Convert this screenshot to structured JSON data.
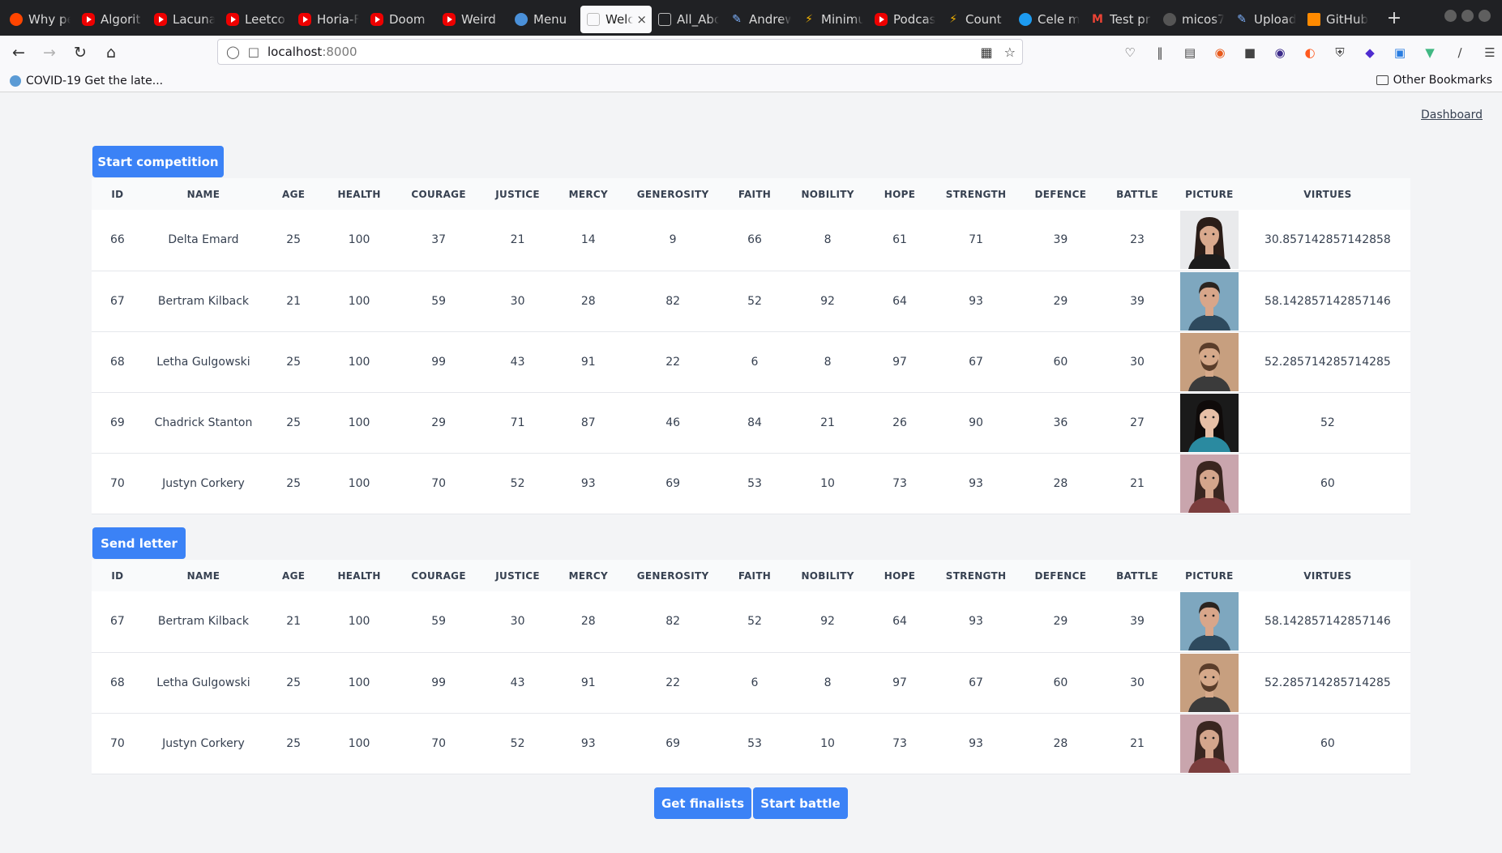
{
  "browser": {
    "tabs": [
      {
        "label": "Why pe",
        "icon": "reddit-icon"
      },
      {
        "label": "Algorit",
        "icon": "youtube-icon"
      },
      {
        "label": "Lacuna",
        "icon": "youtube-icon"
      },
      {
        "label": "Leetco",
        "icon": "youtube-icon"
      },
      {
        "label": "Horia-F",
        "icon": "youtube-icon"
      },
      {
        "label": "Doom",
        "icon": "youtube-icon"
      },
      {
        "label": "Weird",
        "icon": "youtube-icon"
      },
      {
        "label": "Menu",
        "icon": "globe-icon"
      },
      {
        "label": "Welcom",
        "icon": "blank-page-icon",
        "active": true
      },
      {
        "label": "All_About",
        "icon": "blank-page-icon"
      },
      {
        "label": "Andrew",
        "icon": "pen-icon"
      },
      {
        "label": "Minimu",
        "icon": "bolt-icon"
      },
      {
        "label": "Podcas",
        "icon": "youtube-icon"
      },
      {
        "label": "Count",
        "icon": "bolt-icon"
      },
      {
        "label": "Cele m",
        "icon": "twitter-bird-icon"
      },
      {
        "label": "Test pr",
        "icon": "gmail-icon"
      },
      {
        "label": "micos7",
        "icon": "github-icon"
      },
      {
        "label": "Upload",
        "icon": "pen-icon"
      },
      {
        "label": "GitHub",
        "icon": "grid-icon"
      }
    ],
    "url_host": "localhost",
    "url_port": ":8000",
    "bookmark": "COVID-19 Get the late...",
    "other_bookmarks": "Other Bookmarks",
    "accent": "#3b82f6"
  },
  "page": {
    "dashboard_link": "Dashboard",
    "start_competition": "Start competition",
    "send_letter": "Send letter",
    "get_finalists": "Get finalists",
    "start_battle": "Start battle"
  },
  "columns": [
    "ID",
    "NAME",
    "AGE",
    "HEALTH",
    "COURAGE",
    "JUSTICE",
    "MERCY",
    "GENEROSITY",
    "FAITH",
    "NOBILITY",
    "HOPE",
    "STRENGTH",
    "DEFENCE",
    "BATTLE",
    "PICTURE",
    "VIRTUES"
  ],
  "competitors": [
    {
      "id": "66",
      "name": "Delta Emard",
      "age": "25",
      "health": "100",
      "courage": "37",
      "justice": "21",
      "mercy": "14",
      "generosity": "9",
      "faith": "66",
      "nobility": "8",
      "hope": "61",
      "strength": "71",
      "defence": "39",
      "battle": "23",
      "picture": "portrait-woman-dark-hair",
      "virtues": "30.857142857142858"
    },
    {
      "id": "67",
      "name": "Bertram Kilback",
      "age": "21",
      "health": "100",
      "courage": "59",
      "justice": "30",
      "mercy": "28",
      "generosity": "82",
      "faith": "52",
      "nobility": "92",
      "hope": "64",
      "strength": "93",
      "defence": "29",
      "battle": "39",
      "picture": "portrait-man-short-hair",
      "virtues": "58.142857142857146"
    },
    {
      "id": "68",
      "name": "Letha Gulgowski",
      "age": "25",
      "health": "100",
      "courage": "99",
      "justice": "43",
      "mercy": "91",
      "generosity": "22",
      "faith": "6",
      "nobility": "8",
      "hope": "97",
      "strength": "67",
      "defence": "60",
      "battle": "30",
      "picture": "portrait-man-beard",
      "virtues": "52.285714285714285"
    },
    {
      "id": "69",
      "name": "Chadrick Stanton",
      "age": "25",
      "health": "100",
      "courage": "29",
      "justice": "71",
      "mercy": "87",
      "generosity": "46",
      "faith": "84",
      "nobility": "21",
      "hope": "26",
      "strength": "90",
      "defence": "36",
      "battle": "27",
      "picture": "portrait-woman-long-dark-hair",
      "virtues": "52"
    },
    {
      "id": "70",
      "name": "Justyn Corkery",
      "age": "25",
      "health": "100",
      "courage": "70",
      "justice": "52",
      "mercy": "93",
      "generosity": "69",
      "faith": "53",
      "nobility": "10",
      "hope": "73",
      "strength": "93",
      "defence": "28",
      "battle": "21",
      "picture": "portrait-woman-scarf",
      "virtues": "60"
    }
  ],
  "letters": [
    {
      "id": "67",
      "name": "Bertram Kilback",
      "age": "21",
      "health": "100",
      "courage": "59",
      "justice": "30",
      "mercy": "28",
      "generosity": "82",
      "faith": "52",
      "nobility": "92",
      "hope": "64",
      "strength": "93",
      "defence": "29",
      "battle": "39",
      "picture": "portrait-man-short-hair",
      "virtues": "58.142857142857146"
    },
    {
      "id": "68",
      "name": "Letha Gulgowski",
      "age": "25",
      "health": "100",
      "courage": "99",
      "justice": "43",
      "mercy": "91",
      "generosity": "22",
      "faith": "6",
      "nobility": "8",
      "hope": "97",
      "strength": "67",
      "defence": "60",
      "battle": "30",
      "picture": "portrait-man-beard",
      "virtues": "52.285714285714285"
    },
    {
      "id": "70",
      "name": "Justyn Corkery",
      "age": "25",
      "health": "100",
      "courage": "70",
      "justice": "52",
      "mercy": "93",
      "generosity": "69",
      "faith": "53",
      "nobility": "10",
      "hope": "73",
      "strength": "93",
      "defence": "28",
      "battle": "21",
      "picture": "portrait-woman-scarf",
      "virtues": "60"
    }
  ]
}
